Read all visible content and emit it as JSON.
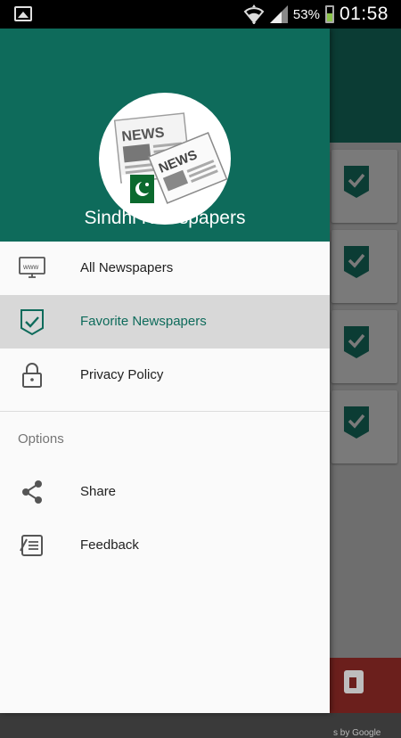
{
  "status_bar": {
    "battery_percent": "53%",
    "time": "01:58",
    "icons": [
      "gallery-icon",
      "wifi-icon",
      "signal-icon",
      "battery-icon"
    ]
  },
  "drawer": {
    "app_title": "Sindhi Newspapers",
    "logo_texts": [
      "NEWS",
      "NEWS"
    ],
    "items": [
      {
        "label": "All Newspapers",
        "icon": "www-monitor-icon",
        "active": false
      },
      {
        "label": "Favorite Newspapers",
        "icon": "shield-check-icon",
        "active": true
      },
      {
        "label": "Privacy Policy",
        "icon": "lock-icon",
        "active": false
      }
    ],
    "section_title": "Options",
    "options": [
      {
        "label": "Share",
        "icon": "share-icon"
      },
      {
        "label": "Feedback",
        "icon": "feedback-icon"
      }
    ]
  },
  "background": {
    "ad_attribution": "s by Google"
  },
  "colors": {
    "primary": "#0e6b5b",
    "active_bg": "#d8d8d8",
    "accent_dark": "#0b3c34"
  }
}
